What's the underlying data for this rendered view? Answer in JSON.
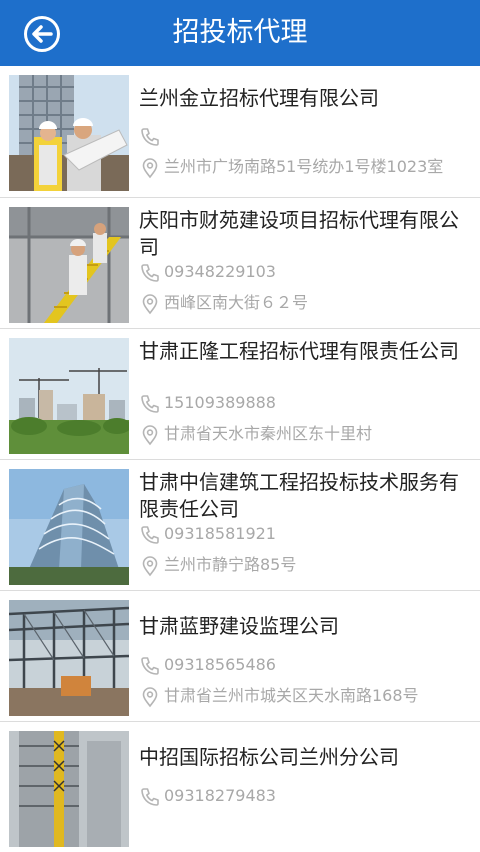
{
  "header": {
    "title": "招投标代理"
  },
  "items": [
    {
      "name": "兰州金立招标代理有限公司",
      "phone": "",
      "address": "兰州市广场南路51号统办1号楼1023室"
    },
    {
      "name": "庆阳市财苑建设项目招标代理有限公司",
      "phone": "09348229103",
      "address": "西峰区南大街６２号"
    },
    {
      "name": "甘肃正隆工程招标代理有限责任公司",
      "phone": "15109389888",
      "address": "甘肃省天水市秦州区东十里村"
    },
    {
      "name": "甘肃中信建筑工程招投标技术服务有限责任公司",
      "phone": "09318581921",
      "address": "兰州市静宁路85号"
    },
    {
      "name": "甘肃蓝野建设监理公司",
      "phone": "09318565486",
      "address": "甘肃省兰州市城关区天水南路168号"
    },
    {
      "name": "中招国际招标公司兰州分公司",
      "phone": "09318279483",
      "address": ""
    }
  ],
  "colors": {
    "header": "#1e6fcb",
    "icon": "#b5b5b5"
  },
  "icons": {
    "back": "back-arrow-circle-icon",
    "phone": "phone-icon",
    "location": "location-pin-icon"
  }
}
